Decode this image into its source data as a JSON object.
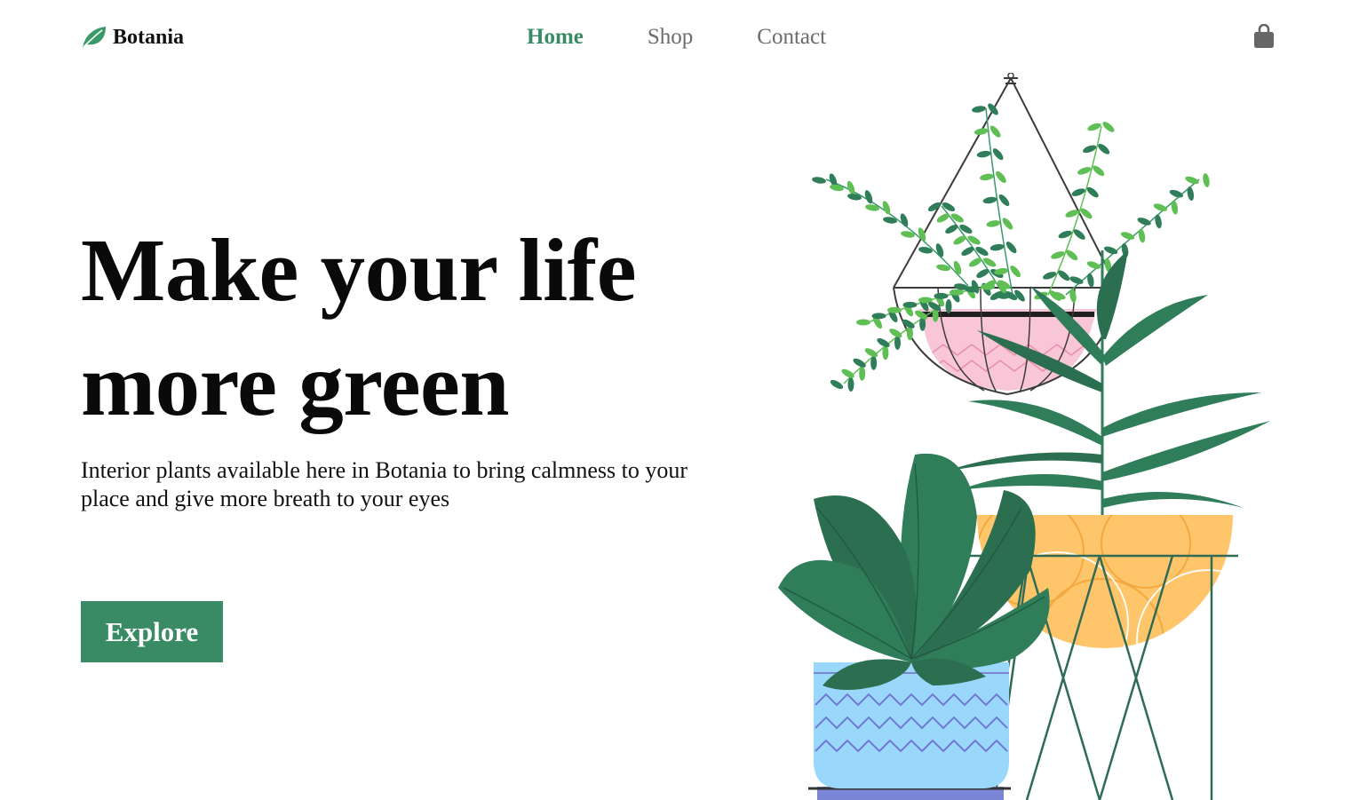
{
  "brand": {
    "name": "Botania",
    "logo_icon": "leaf-icon",
    "accent_color": "#388b62"
  },
  "nav": {
    "items": [
      {
        "label": "Home",
        "active": true
      },
      {
        "label": "Shop",
        "active": false
      },
      {
        "label": "Contact",
        "active": false
      }
    ],
    "cart_icon": "shopping-bag-icon"
  },
  "hero": {
    "title_line_1": "Make your life",
    "title_line_2": "more green",
    "subtitle": "Interior plants available here in Botania to bring calmness to your place and give more breath to your eyes",
    "cta_label": "Explore"
  },
  "illustration": {
    "subject": "potted-plants-illustration",
    "colors": {
      "leaf_dark": "#2f7d59",
      "leaf_light": "#5fbf55",
      "pot_blue": "#9ad8fb",
      "pot_yellow": "#fec56b",
      "pot_pink": "#f8c6d6",
      "stand": "#2f6b55"
    }
  }
}
